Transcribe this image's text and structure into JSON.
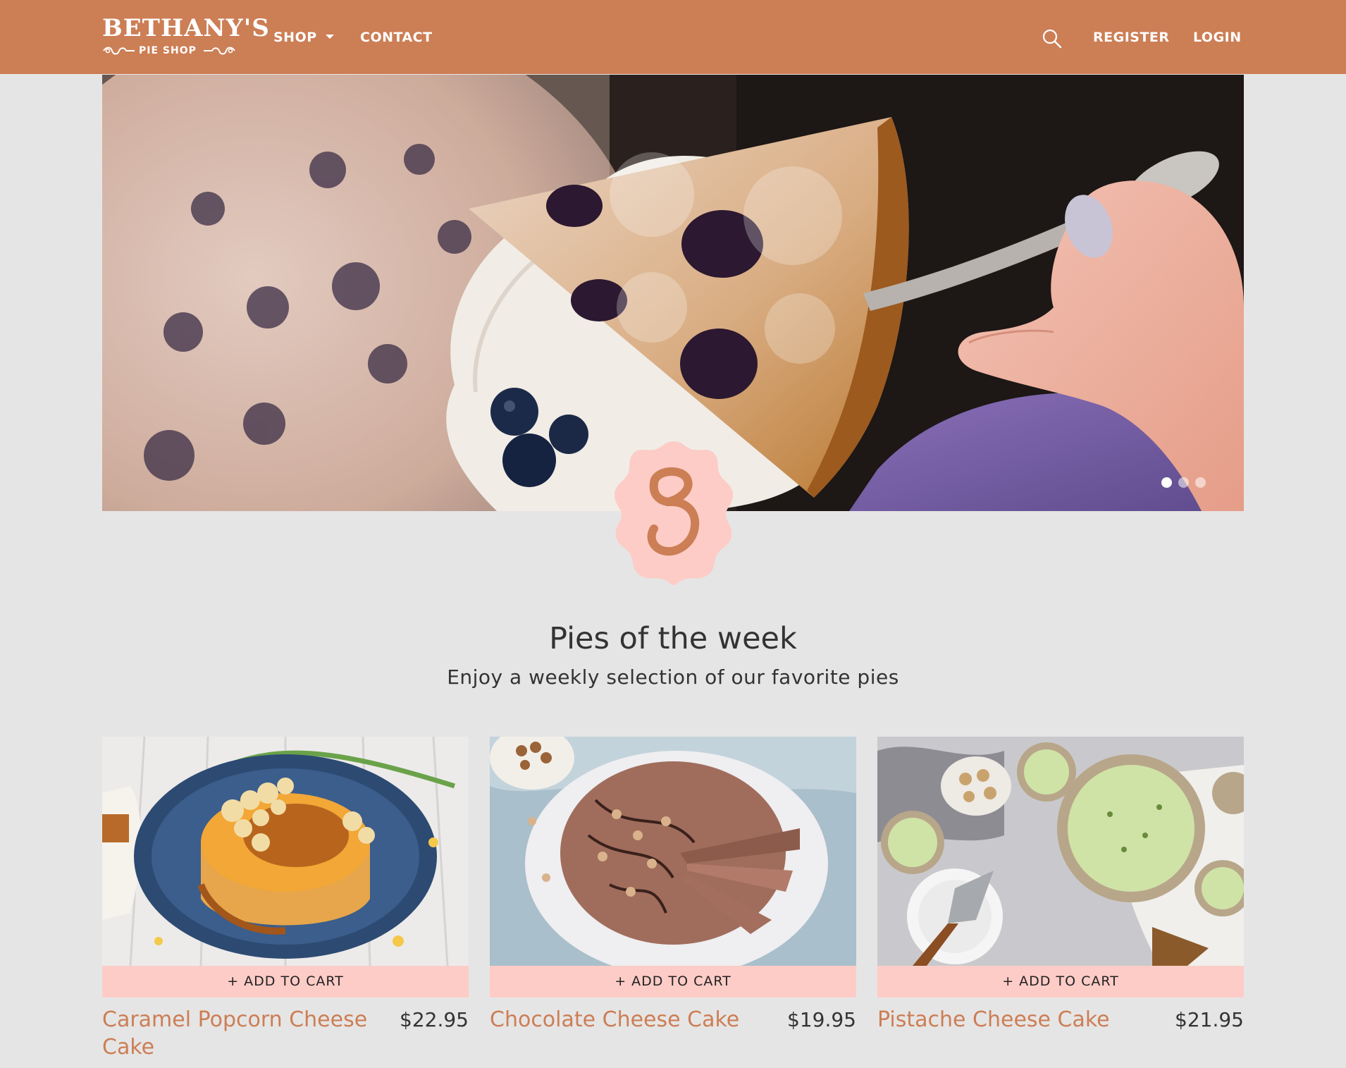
{
  "brand": {
    "name": "BETHANY'S",
    "tagline": "PIE SHOP",
    "primary_color": "#cc7e55",
    "accent_color": "#fdccc7",
    "background_color": "#e6e5e5"
  },
  "nav": {
    "shop_label": "SHOP",
    "contact_label": "CONTACT",
    "search_icon": "search-icon",
    "register_label": "REGISTER",
    "login_label": "LOGIN"
  },
  "hero": {
    "image": "blueberry-pie-slice-photo",
    "slides_total": 3,
    "active_slide": 1,
    "badge_letter": "B"
  },
  "section": {
    "title": "Pies of the week",
    "subtitle": "Enjoy a weekly selection of our favorite pies"
  },
  "products": [
    {
      "name": "Caramel Popcorn Cheese Cake",
      "price": "$22.95",
      "cta": "+ ADD TO CART",
      "image": "caramel-popcorn-cheesecake-photo"
    },
    {
      "name": "Chocolate Cheese Cake",
      "price": "$19.95",
      "cta": "+ ADD TO CART",
      "image": "chocolate-cheesecake-photo"
    },
    {
      "name": "Pistache Cheese Cake",
      "price": "$21.95",
      "cta": "+ ADD TO CART",
      "image": "pistachio-cheesecake-photo"
    }
  ]
}
